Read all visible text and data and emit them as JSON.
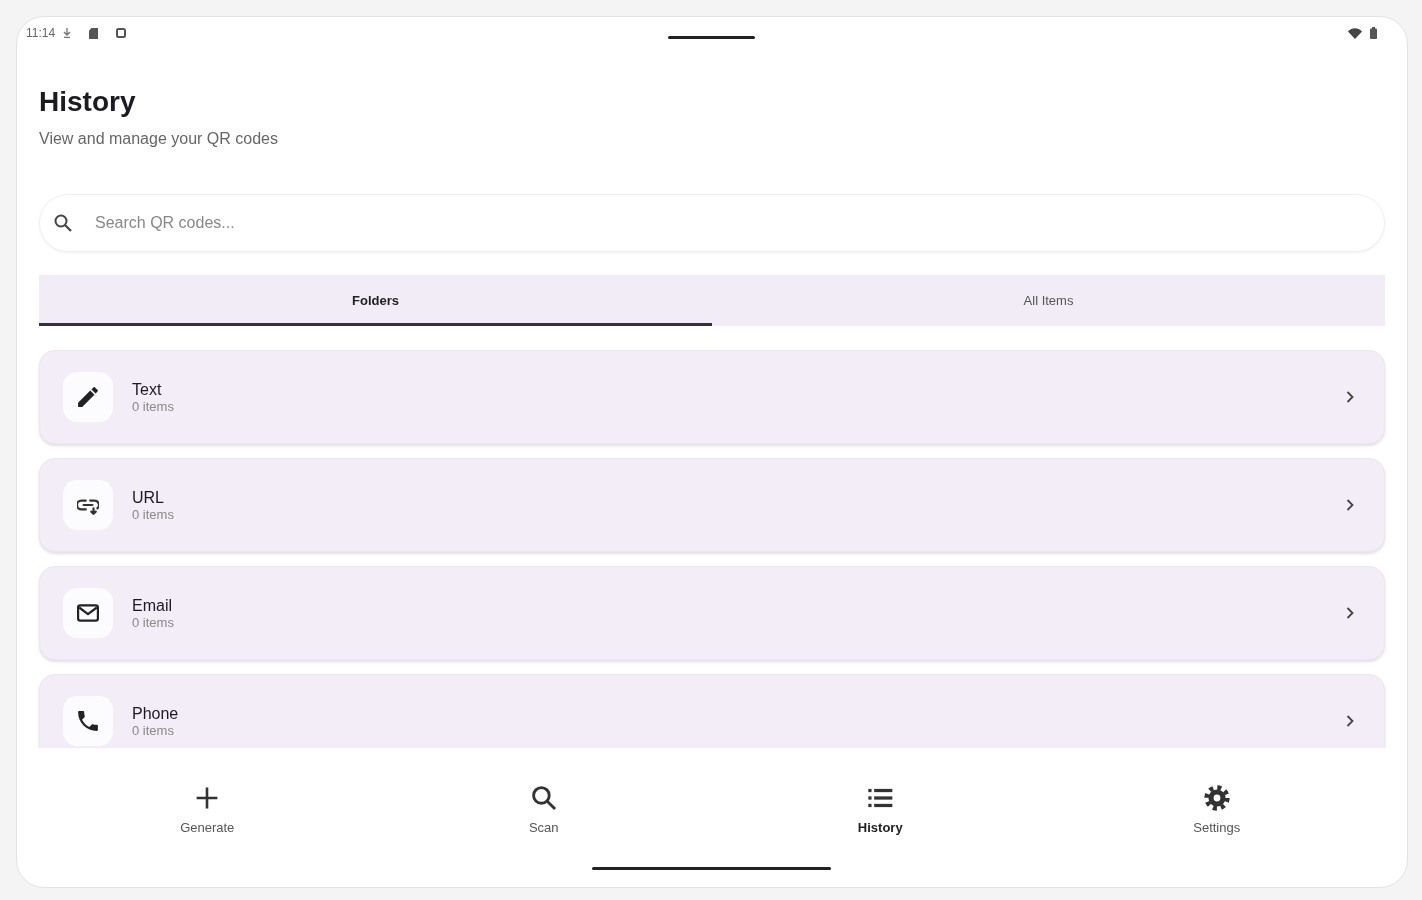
{
  "status_bar": {
    "time": "11:14"
  },
  "header": {
    "title": "History",
    "subtitle": "View and manage your QR codes"
  },
  "search": {
    "placeholder": "Search QR codes..."
  },
  "tabs": [
    {
      "label": "Folders",
      "selected": true
    },
    {
      "label": "All Items",
      "selected": false
    }
  ],
  "folders": [
    {
      "kind": "text",
      "name": "Text",
      "count": "0 items"
    },
    {
      "kind": "url",
      "name": "URL",
      "count": "0 items"
    },
    {
      "kind": "email",
      "name": "Email",
      "count": "0 items"
    },
    {
      "kind": "phone",
      "name": "Phone",
      "count": "0 items"
    }
  ],
  "bottom_nav": [
    {
      "kind": "generate",
      "label": "Generate",
      "selected": false
    },
    {
      "kind": "scan",
      "label": "Scan",
      "selected": false
    },
    {
      "kind": "history",
      "label": "History",
      "selected": true
    },
    {
      "kind": "settings",
      "label": "Settings",
      "selected": false
    }
  ]
}
